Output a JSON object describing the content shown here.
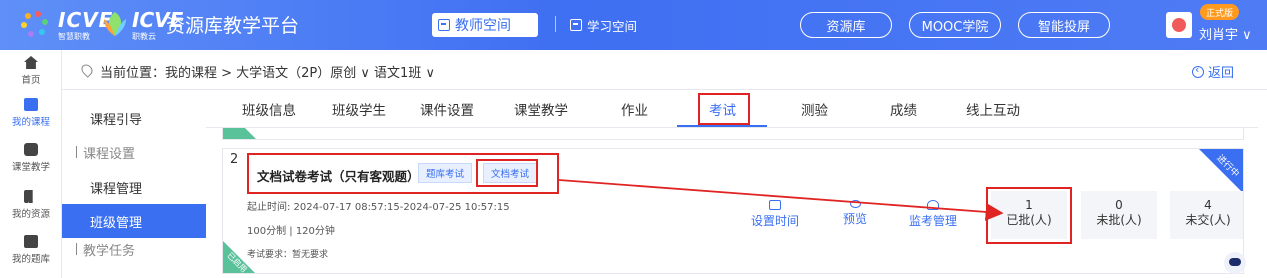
{
  "header": {
    "logo1_text": "ICVE",
    "logo1_sub": "智慧职教",
    "logo2_text": "ICVE",
    "logo2_sub": "职教云",
    "platform_title": "资源库教学平台",
    "teacher_space": "教师空间",
    "student_space": "学习空间",
    "links": [
      "资源库",
      "MOOC学院",
      "智能投屏"
    ],
    "badge": "正式版",
    "user_name": "刘肖宇 ∨"
  },
  "sidebar": {
    "items": [
      {
        "label": "首页",
        "icon": "home-icon"
      },
      {
        "label": "我的课程",
        "icon": "book-icon"
      },
      {
        "label": "课堂教学",
        "icon": "play-icon"
      },
      {
        "label": "我的资源",
        "icon": "library-icon"
      },
      {
        "label": "我的题库",
        "icon": "question-bank-icon"
      }
    ]
  },
  "breadcrumb": {
    "text": "当前位置：我的课程 > 大学语文（2P）原创 ∨  语文1班 ∨",
    "back": "返回"
  },
  "sub_menu": {
    "items": [
      "课程引导",
      "课程设置",
      "课程管理",
      "班级管理",
      "教学任务"
    ]
  },
  "tabs": [
    "班级信息",
    "班级学生",
    "课件设置",
    "课堂教学",
    "作业",
    "考试",
    "测验",
    "成绩",
    "线上互动"
  ],
  "exam": {
    "index": "2",
    "title": "文档试卷考试（只有客观题）",
    "tags": [
      "题库考试",
      "文档考试"
    ],
    "time": "起止时间: 2024-07-17 08:57:15-2024-07-25 10:57:15",
    "score": "100分制 | 120分钟",
    "requirement": "考试要求：暂无要求",
    "status": "进行中",
    "ribbon": "已启用",
    "actions": [
      {
        "label": "设置时间",
        "icon": "upload-icon"
      },
      {
        "label": "预览",
        "icon": "eye-icon"
      },
      {
        "label": "监考管理",
        "icon": "proctor-icon"
      }
    ],
    "stats": [
      {
        "value": "1",
        "label": "已批(人)"
      },
      {
        "value": "0",
        "label": "未批(人)"
      },
      {
        "value": "4",
        "label": "未交(人)"
      }
    ]
  },
  "colors": {
    "accent": "#3a6ff2",
    "highlight": "#e02424",
    "ribbon": "#59c29a"
  }
}
